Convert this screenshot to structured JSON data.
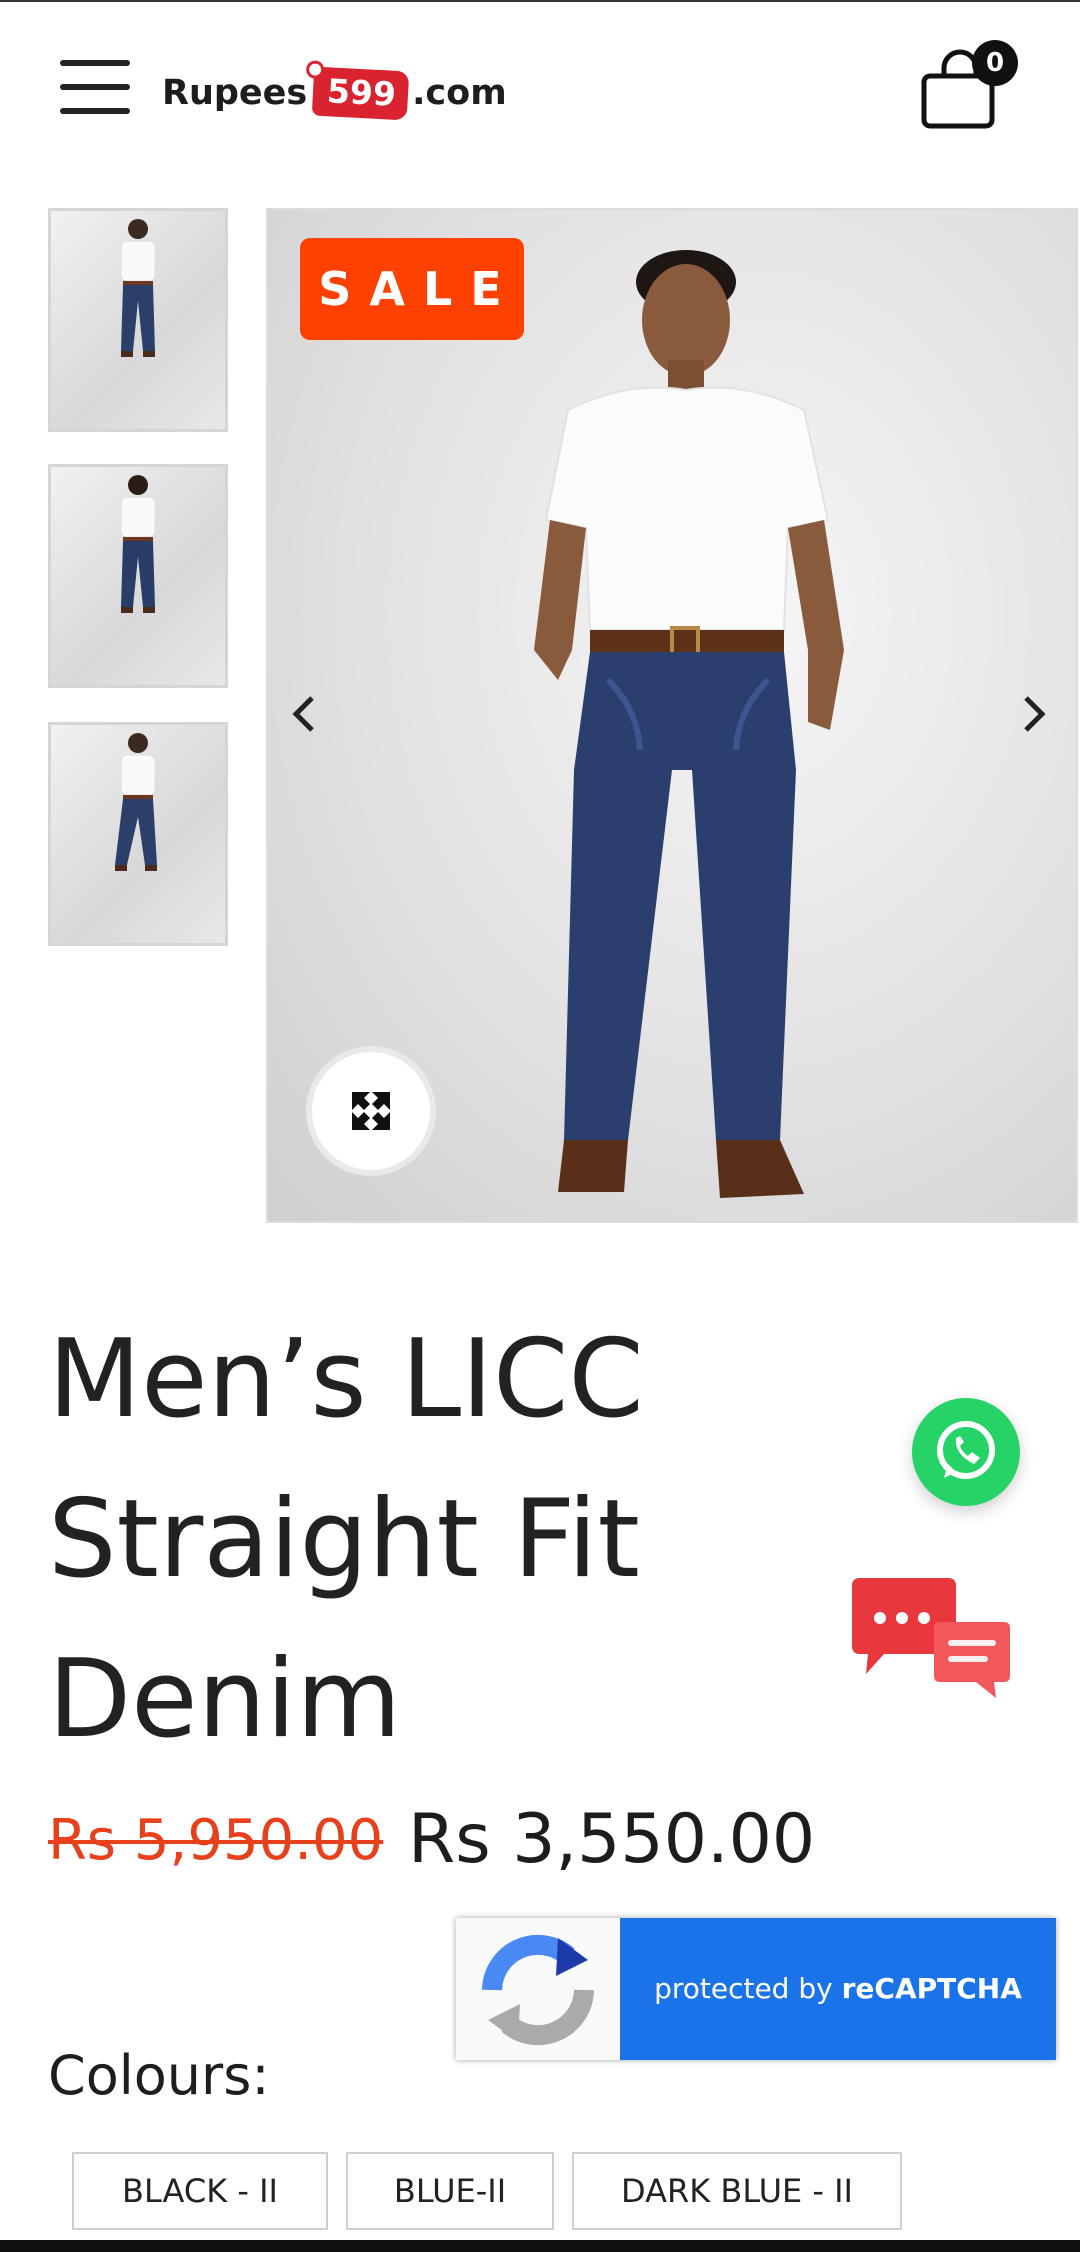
{
  "header": {
    "logo_left": "Rupees",
    "logo_tag": "599",
    "logo_right": ".com",
    "cart_count": "0"
  },
  "gallery": {
    "sale_badge": "SALE",
    "thumbnail_count": 3
  },
  "product": {
    "title": "Men’s LICC Straight Fit Denim",
    "old_price": "Rs 5,950.00",
    "new_price": "Rs 3,550.00"
  },
  "recaptcha": {
    "prefix": "protected by ",
    "brand": "reCAPTCHA"
  },
  "colours": {
    "label": "Colours:",
    "options": [
      "BLACK - II",
      "BLUE-II",
      "DARK BLUE - II"
    ]
  },
  "colors": {
    "sale": "#fe4101",
    "old_price": "#e9401c",
    "whatsapp": "#25d366",
    "recaptcha_blue": "#1a73e8",
    "logo_tag": "#d9232e"
  },
  "icons": [
    "hamburger-icon",
    "cart-icon",
    "chevron-left-icon",
    "chevron-right-icon",
    "expand-icon",
    "whatsapp-icon",
    "chat-bubbles-icon",
    "recaptcha-icon"
  ]
}
